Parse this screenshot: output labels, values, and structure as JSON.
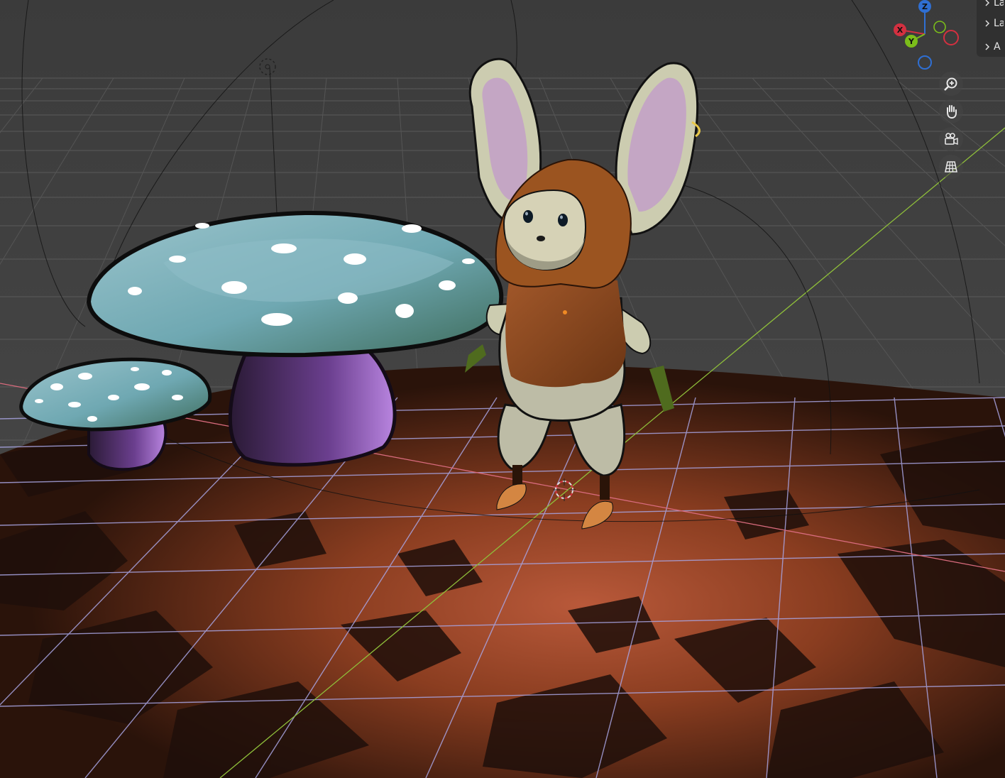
{
  "outliner": {
    "items": [
      {
        "label": "La",
        "icon": "chevron-right-icon"
      },
      {
        "label": "La",
        "icon": "chevron-right-icon"
      },
      {
        "label": "A",
        "icon": "chevron-right-icon"
      }
    ]
  },
  "gizmo": {
    "axes": [
      {
        "label": "Z",
        "color": "#2f6fd3"
      },
      {
        "label": "X",
        "color": "#d33040"
      },
      {
        "label": "Y",
        "color": "#7bbd1a"
      }
    ]
  },
  "nav_tools": [
    {
      "name": "zoom-icon"
    },
    {
      "name": "pan-hand-icon"
    },
    {
      "name": "camera-view-icon"
    },
    {
      "name": "orthographic-grid-icon"
    }
  ],
  "colors": {
    "viewport_bg": "#3d3d3d",
    "floor_lines": "#a7a3e0",
    "ground_dark": "#1f0f0a",
    "ground_warm": "#8a3d20",
    "axis_x": "#d86b7d",
    "axis_y": "#8fbf3a"
  }
}
